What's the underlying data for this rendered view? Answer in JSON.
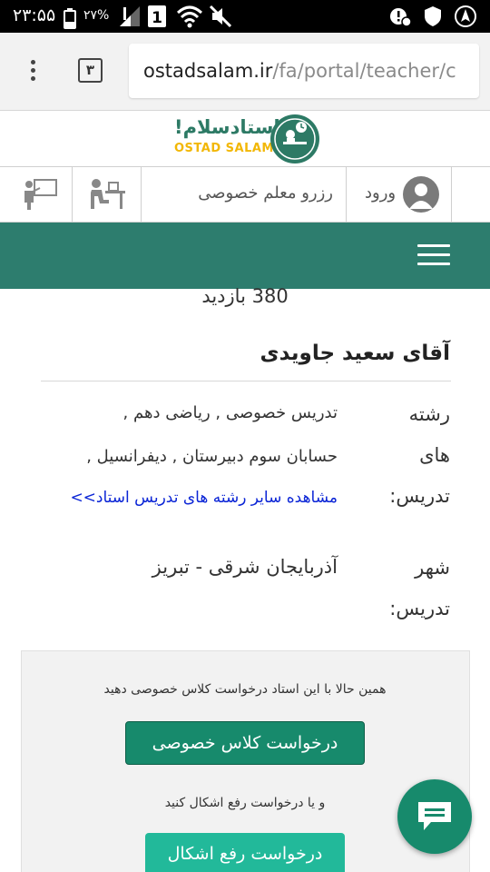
{
  "status_bar": {
    "time": "۲۳:۵۵",
    "battery_percent": "۲۷%",
    "sim_slot": "1"
  },
  "browser": {
    "tab_count": "۳",
    "url_host": "ostadsalam.ir",
    "url_path": "/fa/portal/teacher/c"
  },
  "site": {
    "logo_fa": "استادسلام!",
    "logo_en": "OSTAD SALAM!",
    "nav": {
      "login_label": "ورود",
      "private_teacher_label": "رزرو معلم خصوصی"
    }
  },
  "teacher": {
    "visits": "380 بازدید",
    "name": "آقای سعید جاویدی",
    "fields_label_lines": [
      "رشته",
      "های",
      "تدریس:"
    ],
    "fields_line1": "تدریس خصوصی ,  ریاضی دهم ,",
    "fields_line2": "حسابان سوم دبیرستان ,  دیفرانسیل ,",
    "more_fields_link": "مشاهده سایر رشته های تدریس استاد>>",
    "city_label_lines": [
      "شهر",
      "تدریس:"
    ],
    "city": "آذربایجان شرقی - تبریز"
  },
  "request": {
    "prompt_private": "همین حالا با این استاد درخواست کلاس خصوصی دهید",
    "button_private": "درخواست کلاس خصوصی",
    "prompt_solve": "و یا درخواست رفع اشکال کنید",
    "button_solve": "درخواست رفع اشکال"
  },
  "colors": {
    "brand_teal": "#2d7d6e",
    "button_green": "#178a6c",
    "button_light_green": "#22b99a",
    "link_blue": "#0b25d6",
    "logo_yellow": "#f2b705"
  },
  "icons": {
    "status_left": [
      "alert-icon",
      "shield-icon",
      "location-icon"
    ],
    "status_right": [
      "signal-icon",
      "sim-icon",
      "wifi-icon",
      "mute-icon"
    ],
    "nav": [
      "presenter-icon",
      "student-desk-icon",
      "user-avatar-icon"
    ],
    "fab": "chat-icon"
  }
}
